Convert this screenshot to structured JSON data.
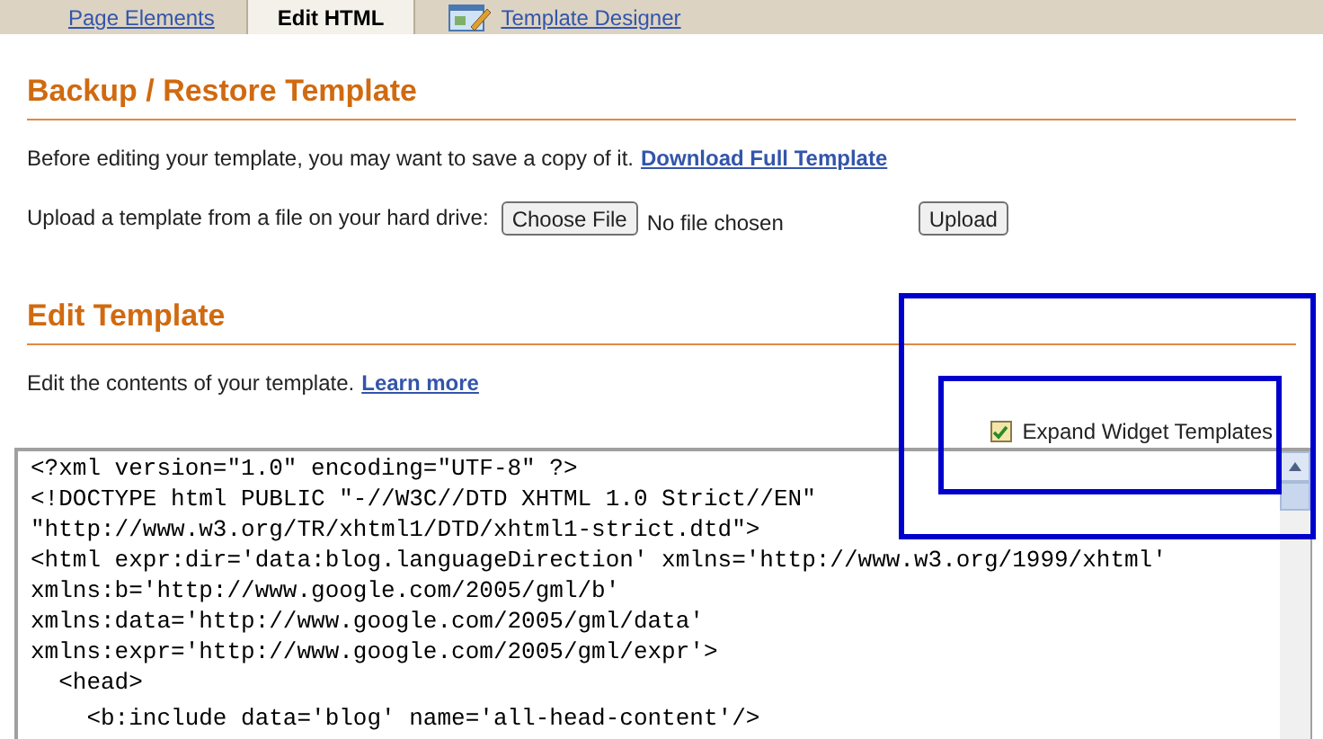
{
  "tabs": [
    {
      "label": "Page Elements",
      "selected": false,
      "kind": "link"
    },
    {
      "label": "Edit HTML",
      "selected": true,
      "kind": "link"
    },
    {
      "label": "Template Designer",
      "selected": false,
      "kind": "designer"
    }
  ],
  "backup": {
    "heading": "Backup / Restore Template",
    "intro": "Before editing your template, you may want to save a copy of it.",
    "download_link": "Download Full Template",
    "upload_label": "Upload a template from a file on your hard drive:",
    "choose_button": "Choose File",
    "file_status": "No file chosen",
    "upload_button": "Upload"
  },
  "edit": {
    "heading": "Edit Template",
    "intro": "Edit the contents of your template.",
    "learn_link": "Learn more",
    "expand_widgets": {
      "label": "Expand Widget Templates",
      "checked": true
    },
    "code_lines": [
      {
        "kind": "code",
        "text": "<?xml version=\"1.0\" encoding=\"UTF-8\" ?>"
      },
      {
        "kind": "code",
        "text": "<!DOCTYPE html PUBLIC \"-//W3C//DTD XHTML 1.0 Strict//EN\""
      },
      {
        "kind": "code",
        "text": "\"http://www.w3.org/TR/xhtml1/DTD/xhtml1-strict.dtd\">"
      },
      {
        "kind": "code",
        "text": "<html expr:dir='data:blog.languageDirection' xmlns='http://www.w3.org/1999/xhtml'"
      },
      {
        "kind": "code",
        "text": "xmlns:b='http://www.google.com/2005/gml/b'"
      },
      {
        "kind": "code",
        "text": "xmlns:data='http://www.google.com/2005/gml/data'"
      },
      {
        "kind": "code",
        "text": "xmlns:expr='http://www.google.com/2005/gml/expr'>"
      },
      {
        "kind": "code",
        "text": "  <head>"
      },
      {
        "kind": "blank"
      },
      {
        "kind": "code",
        "text": "    <b:include data='blog' name='all-head-content'/>"
      }
    ]
  },
  "annotations": [
    {
      "kind": "box",
      "color": "#0000cc"
    },
    {
      "kind": "box",
      "color": "#0000cc"
    }
  ]
}
